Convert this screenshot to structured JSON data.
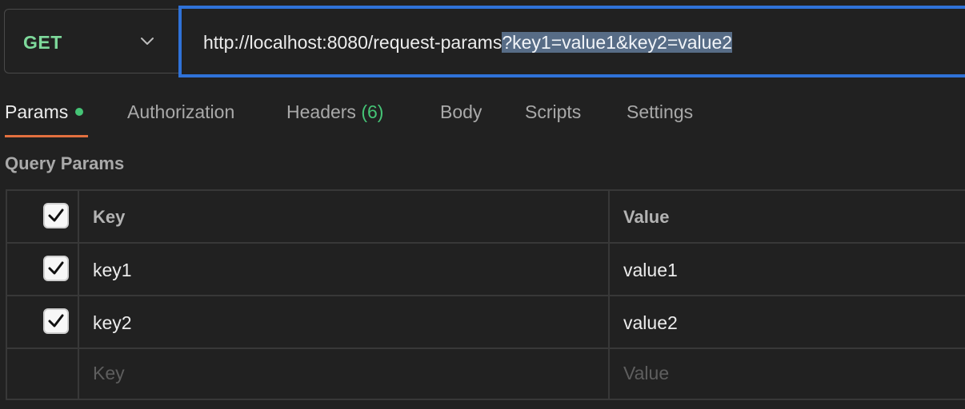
{
  "request": {
    "method": "GET",
    "url_base": "http://localhost:8080/request-params",
    "url_query": "?key1=value1&key2=value2"
  },
  "tabs": [
    {
      "label": "Params",
      "active": true,
      "has_dot": true
    },
    {
      "label": "Authorization"
    },
    {
      "label": "Headers",
      "count": "(6)"
    },
    {
      "label": "Body"
    },
    {
      "label": "Scripts"
    },
    {
      "label": "Settings"
    }
  ],
  "section_title": "Query Params",
  "table": {
    "headers": {
      "key": "Key",
      "value": "Value"
    },
    "rows": [
      {
        "key": "key1",
        "value": "value1",
        "checked": true
      },
      {
        "key": "key2",
        "value": "value2",
        "checked": true
      }
    ],
    "placeholder": {
      "key": "Key",
      "value": "Value"
    }
  },
  "colors": {
    "accent_focus": "#2f72d8",
    "tab_underline": "#e3703f",
    "status_green": "#45c476",
    "selection": "#576c86"
  },
  "icons": [
    "chevron-down-icon",
    "checkmark-icon",
    "status-dot-icon"
  ]
}
